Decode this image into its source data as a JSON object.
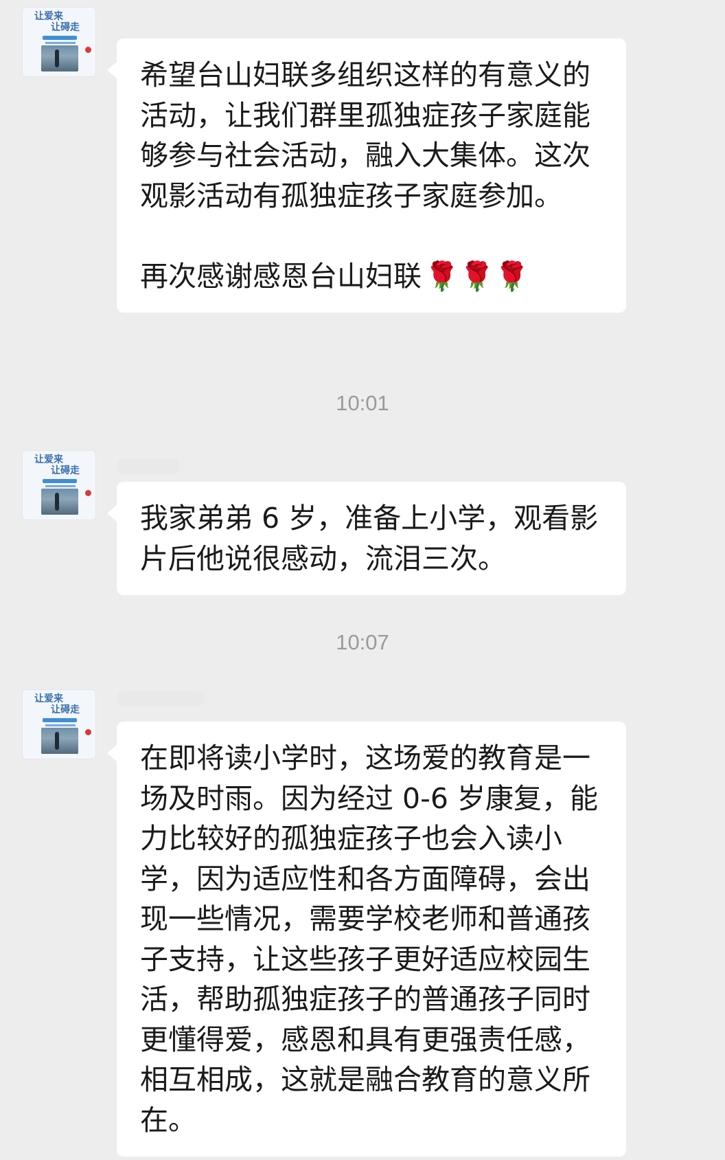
{
  "messages": [
    {
      "avatar_title_1": "让爱来",
      "avatar_title_2": "让碍走",
      "text": "希望台山妇联多组织这样的有意义的活动，让我们群里孤独症孩子家庭能够参与社会活动，融入大集体。这次观影活动有孤独症孩子家庭参加。\n\n再次感谢感恩台山妇联",
      "emoji": "🌹🌹🌹"
    },
    {
      "avatar_title_1": "让爱来",
      "avatar_title_2": "让碍走",
      "text": "我家弟弟 6 岁，准备上小学，观看影片后他说很感动，流泪三次。"
    },
    {
      "avatar_title_1": "让爱来",
      "avatar_title_2": "让碍走",
      "text": "在即将读小学时，这场爱的教育是一场及时雨。因为经过 0-6 岁康复，能力比较好的孤独症孩子也会入读小学，因为适应性和各方面障碍，会出现一些情况，需要学校老师和普通孩子支持，让这些孩子更好适应校园生活，帮助孤独症孩子的普通孩子同时更懂得爱，感恩和具有更强责任感，相互相成，这就是融合教育的意义所在。"
    }
  ],
  "timestamps": [
    "10:01",
    "10:07"
  ],
  "colors": {
    "background": "#ededed",
    "bubble": "#ffffff",
    "text": "#1a1a1a",
    "timestamp": "#9a9a9a"
  }
}
